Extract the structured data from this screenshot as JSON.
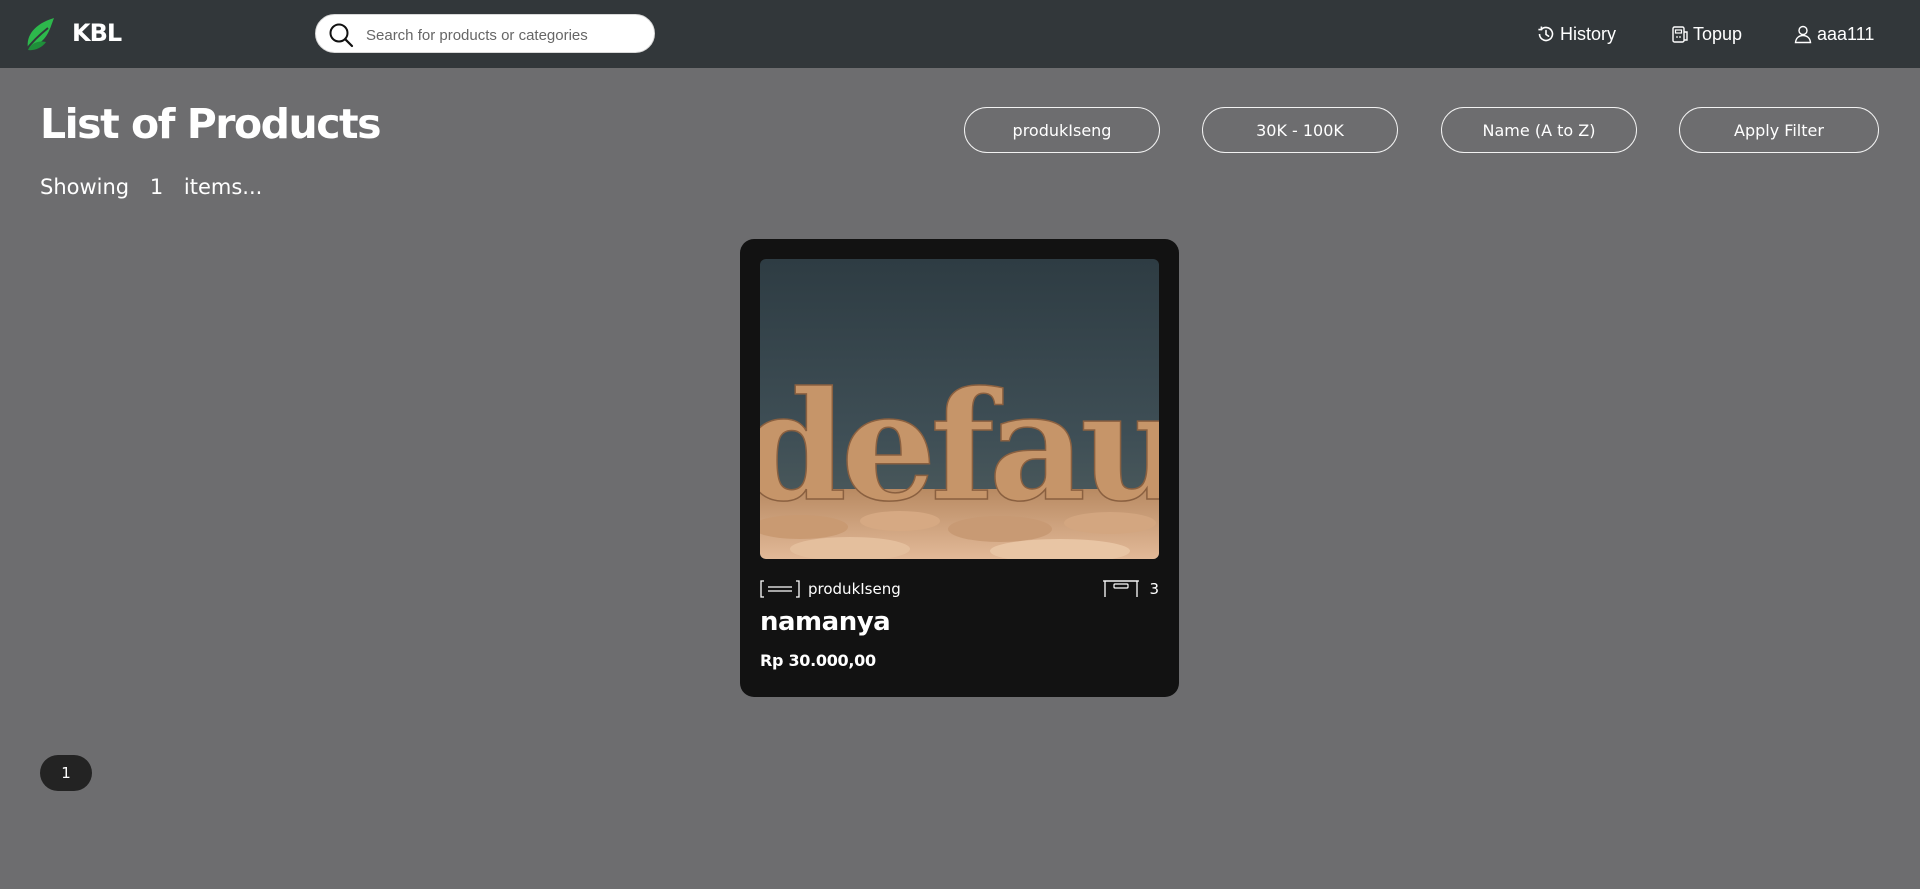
{
  "navbar": {
    "brand": "KBL",
    "logo_icon": "leaf-icon",
    "search": {
      "placeholder": "Search for products or categories",
      "value": ""
    },
    "links": [
      {
        "label": "History",
        "icon": "history-icon"
      },
      {
        "label": "Topup",
        "icon": "wallet-icon"
      },
      {
        "label": "aaa111",
        "icon": "user-icon"
      }
    ],
    "brand_color": "#2db84c"
  },
  "main": {
    "title": "List of Products",
    "showing": {
      "prefix": "Showing",
      "count": "1",
      "suffix": "items..."
    },
    "filters": [
      {
        "label": "produkIseng"
      },
      {
        "label": "30K - 100K"
      },
      {
        "label": "Name (A to Z)"
      },
      {
        "label": "Apply Filter"
      }
    ]
  },
  "products": [
    {
      "image_text": "defaul",
      "category": "produkIseng",
      "category_icon": "category-icon",
      "stock": "3",
      "stock_icon": "box-icon",
      "name": "namanya",
      "price": "Rp 30.000,00"
    }
  ],
  "pagination": {
    "pages": [
      "1"
    ]
  },
  "colors": {
    "navbar_bg": "#32373a",
    "page_bg": "#6d6d6f",
    "card_bg": "#121212",
    "pagination_bg": "#232323"
  }
}
